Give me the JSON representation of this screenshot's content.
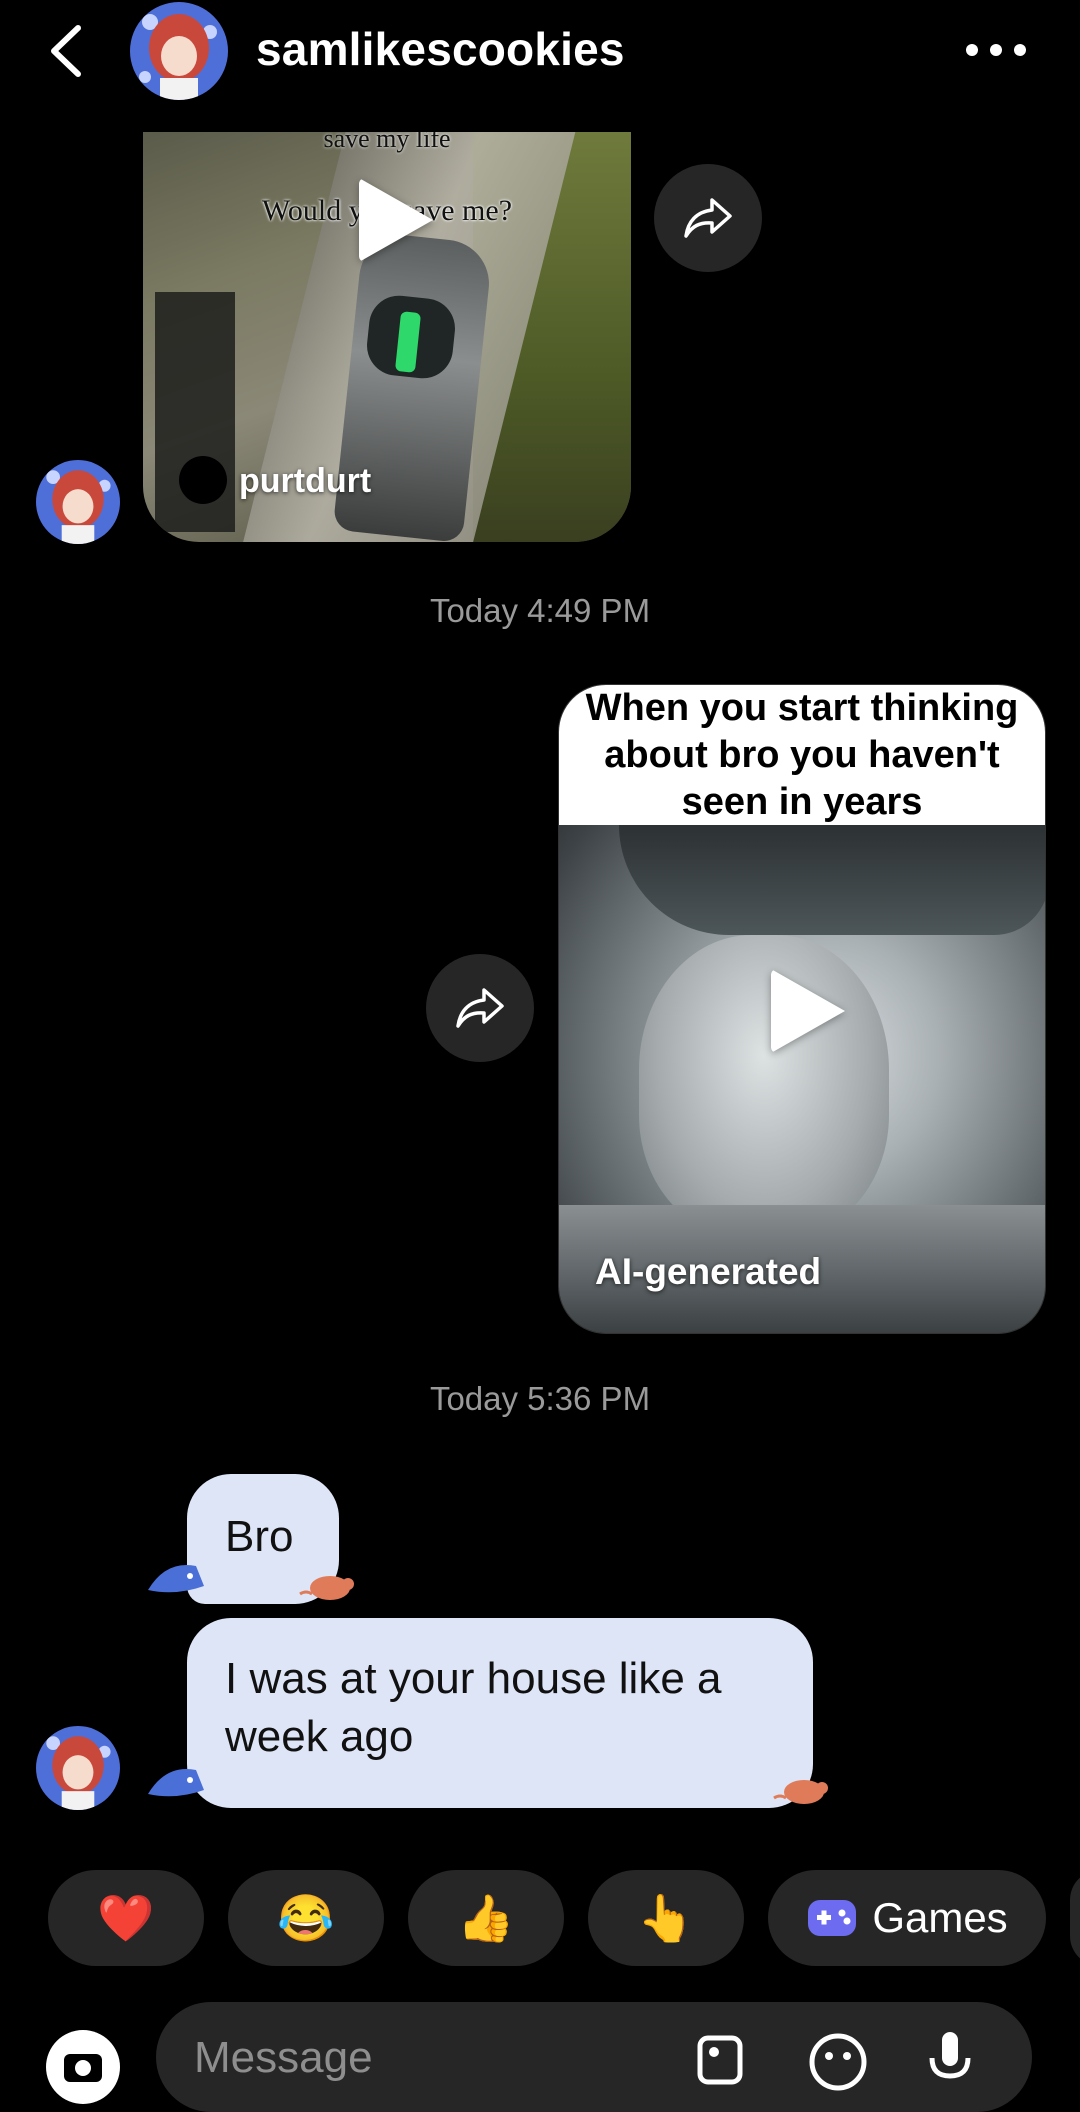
{
  "header": {
    "username": "samlikescookies"
  },
  "messages": {
    "video1": {
      "caption_top": "save my life",
      "caption": "Would you save me?",
      "author": "purtdurt"
    },
    "timestamp1": "Today 4:49 PM",
    "video2": {
      "caption": "When you start thinking\nabout bro you haven't\nseen in years",
      "label": "AI-generated"
    },
    "timestamp2": "Today 5:36 PM",
    "bubble1": "Bro",
    "bubble2": "I was at your house like a week ago"
  },
  "quick_reactions": [
    {
      "icon": "red-heart-icon",
      "glyph": "❤️"
    },
    {
      "icon": "tears-of-joy-icon",
      "glyph": "😂"
    },
    {
      "icon": "thumbs-up-icon",
      "glyph": "👍"
    },
    {
      "icon": "pointing-hand-icon",
      "glyph": "👆"
    }
  ],
  "games_chip": {
    "label": "Games",
    "icon": "gamepad-icon"
  },
  "composer": {
    "placeholder": "Message"
  },
  "colors": {
    "background": "#000000",
    "bubble": "#dde5f6",
    "chip": "#262626",
    "timestamp": "#9a9a9a",
    "games_icon": "#6d6cf0"
  }
}
